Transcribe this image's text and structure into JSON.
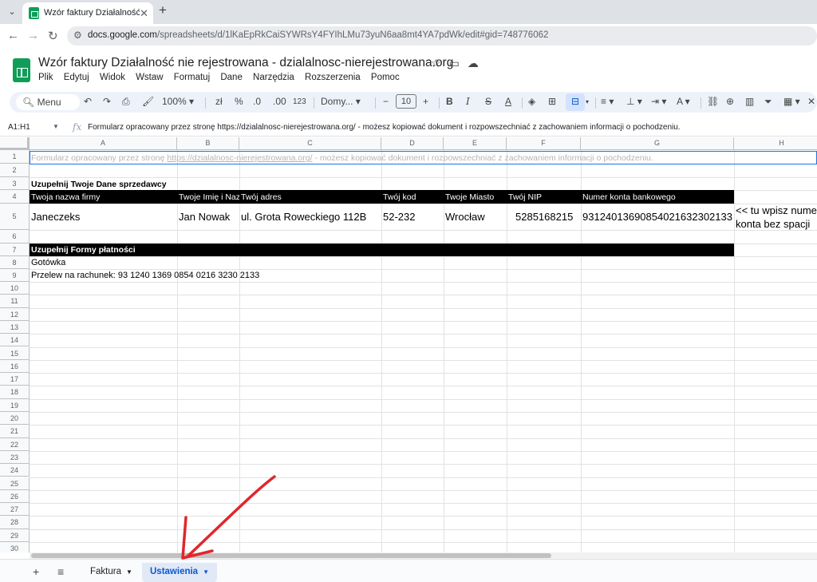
{
  "browser": {
    "tab_title": "Wzór faktury Działalność nie re",
    "url_host": "docs.google.com",
    "url_path": "/spreadsheets/d/1lKaEpRkCaiSYWRsY4FYIhLMu73yuN6aa8mt4YA7pdWk/edit#gid=748776062"
  },
  "doc": {
    "title": "Wzór faktury Działalność nie rejestrowana - dzialalnosc-nierejestrowana.org",
    "menu": [
      "Plik",
      "Edytuj",
      "Widok",
      "Wstaw",
      "Formatuj",
      "Dane",
      "Narzędzia",
      "Rozszerzenia",
      "Pomoc"
    ]
  },
  "toolbar": {
    "search": "Menu",
    "zoom": "100%",
    "currency": "zł",
    "percent": "%",
    "dec_less": ".0",
    "dec_more": ".00",
    "num_format": "123",
    "font": "Domy...",
    "font_size": "10"
  },
  "formula_bar": {
    "range": "A1:H1",
    "fx": "fx",
    "content": "Formularz opracowany przez stronę https://dzialalnosc-nierejestrowana.org/ - możesz kopiować dokument i rozpowszechniać z zachowaniem informacji o pochodzeniu."
  },
  "grid": {
    "columns": [
      "A",
      "B",
      "C",
      "D",
      "E",
      "F",
      "G",
      "H"
    ],
    "rows": [
      "1",
      "2",
      "3",
      "4",
      "5",
      "6",
      "7",
      "8",
      "9",
      "10",
      "11",
      "12",
      "13",
      "14",
      "15",
      "16",
      "17",
      "18",
      "19",
      "20",
      "21",
      "22",
      "23",
      "24",
      "25",
      "26",
      "27",
      "28",
      "29",
      "30"
    ],
    "r1_pre": "Formularz opracowany przez stronę ",
    "r1_link": "https://dzialalnosc-nierejestrowana.org/",
    "r1_post": " - możesz kopiować dokument i rozpowszechniać z zachowaniem informacji o pochodzeniu.",
    "r3": "Uzupełnij Twoje Dane sprzedawcy",
    "r4": [
      "Twoja nazwa firmy",
      "Twoje Imię i Naz",
      "Twój adres",
      "Twój kod",
      "Twoje Miasto",
      "Twój NIP",
      "Numer konta bankowego"
    ],
    "r5": [
      "Janeczeks",
      "Jan Nowak",
      "ul. Grota Roweckiego 112B",
      "52-232",
      "Wrocław",
      "5285168215",
      "93124013690854021632302133"
    ],
    "r5_note_1": "<< tu wpisz numer",
    "r5_note_2": "konta bez spacji",
    "r7": "Uzupełnij Formy płatności",
    "r8": "Gotówka",
    "r9": "Przelew na rachunek: 93 1240 1369 0854 0216 3230 2133"
  },
  "sheets": {
    "tabs": [
      "Faktura",
      "Ustawienia"
    ],
    "active": "Ustawienia"
  },
  "colors": {
    "annotation_arrow": "#e0272b",
    "selection": "#1a73e8",
    "header_bar": "#000000"
  }
}
